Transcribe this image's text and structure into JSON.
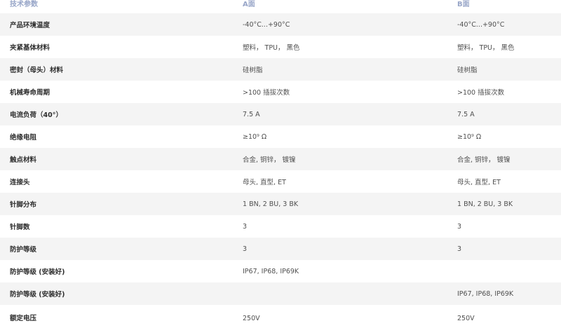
{
  "table": {
    "headers": [
      "技术参数",
      "A面",
      "B面"
    ],
    "rows": [
      {
        "param": "产品环境温度",
        "a": "-40°C...+90°C",
        "b": "-40°C...+90°C"
      },
      {
        "param": "夹紧基体材料",
        "a": "塑料， TPU， 黑色",
        "b": "塑料， TPU， 黑色"
      },
      {
        "param": "密封（母头）材料",
        "a": "硅树脂",
        "b": "硅树脂"
      },
      {
        "param": "机械寿命周期",
        "a": ">100 插拔次数",
        "b": ">100 插拔次数"
      },
      {
        "param": "电流负荷（40°）",
        "a": "7.5 A",
        "b": "7.5 A"
      },
      {
        "param": "绝缘电阻",
        "a": "≥10⁹ Ω",
        "b": "≥10⁹ Ω"
      },
      {
        "param": "触点材料",
        "a": "合金, 铜锌， 镀镍",
        "b": "合金, 铜锌， 镀镍"
      },
      {
        "param": "连接头",
        "a": "母头, 直型, ET",
        "b": "母头, 直型, ET"
      },
      {
        "param": "针脚分布",
        "a": "1 BN, 2 BU, 3 BK",
        "b": "1 BN, 2 BU, 3 BK"
      },
      {
        "param": "针脚数",
        "a": "3",
        "b": "3"
      },
      {
        "param": "防护等级",
        "a": "3",
        "b": "3"
      },
      {
        "param": "防护等级 (安装好)",
        "a": "IP67, IP68, IP69K",
        "b": ""
      },
      {
        "param": "防护等级 (安装好)",
        "a": "",
        "b": "IP67, IP68, IP69K"
      },
      {
        "param": "额定电压",
        "a": "250V",
        "b": "250V"
      }
    ]
  }
}
